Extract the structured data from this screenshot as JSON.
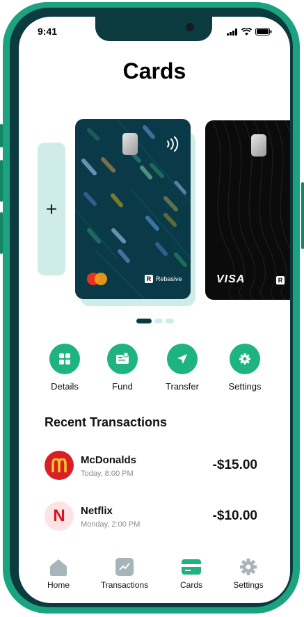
{
  "status_bar": {
    "time": "9:41"
  },
  "page": {
    "title": "Cards"
  },
  "cards": [
    {
      "brand": "Rebasive",
      "network": "mastercard"
    },
    {
      "brand": "R",
      "network": "VISA"
    }
  ],
  "add_card": {
    "label": "+"
  },
  "actions": [
    {
      "label": "Details",
      "icon": "grid-icon"
    },
    {
      "label": "Fund",
      "icon": "wallet-icon"
    },
    {
      "label": "Transfer",
      "icon": "send-icon"
    },
    {
      "label": "Settings",
      "icon": "gear-icon"
    }
  ],
  "recent": {
    "title": "Recent Transactions",
    "items": [
      {
        "name": "McDonalds",
        "time": "Today, 8:00 PM",
        "amount": "-$15.00",
        "logo": "M"
      },
      {
        "name": "Netflix",
        "time": "Monday, 2:00 PM",
        "amount": "-$10.00",
        "logo": "N"
      }
    ]
  },
  "tabs": [
    {
      "label": "Home"
    },
    {
      "label": "Transactions"
    },
    {
      "label": "Cards"
    },
    {
      "label": "Settings"
    }
  ],
  "colors": {
    "accent": "#1db47f",
    "frame": "#1aa37e",
    "dark": "#0b3a3f",
    "card_dark": "#0a3a48",
    "mint": "#cfece8"
  }
}
